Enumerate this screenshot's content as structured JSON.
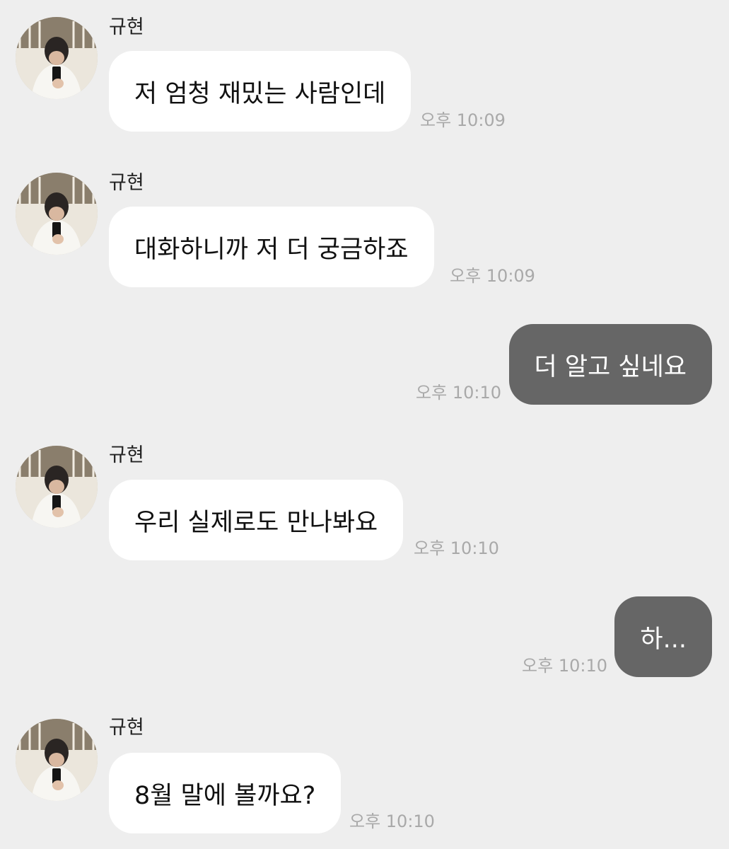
{
  "messages": [
    {
      "from": "other",
      "sender": "규현",
      "text": "저 엄청 재밌는 사람인데",
      "time": "오후 10:09"
    },
    {
      "from": "other",
      "sender": "규현",
      "text": "대화하니까 저 더 궁금하죠",
      "time": "오후 10:09"
    },
    {
      "from": "me",
      "text": "더 알고 싶네요",
      "time": "오후 10:10"
    },
    {
      "from": "other",
      "sender": "규현",
      "text": "우리 실제로도 만나봐요",
      "time": "오후 10:10"
    },
    {
      "from": "me",
      "text": "하...",
      "time": "오후 10:10"
    },
    {
      "from": "other",
      "sender": "규현",
      "text": "8월 말에 볼까요?",
      "time": "오후 10:10"
    }
  ],
  "avatar_icon": "profile-photo",
  "colors": {
    "background": "#eeeeee",
    "incoming_bubble": "#ffffff",
    "outgoing_bubble": "#666666",
    "timestamp": "#a9a9a9"
  }
}
